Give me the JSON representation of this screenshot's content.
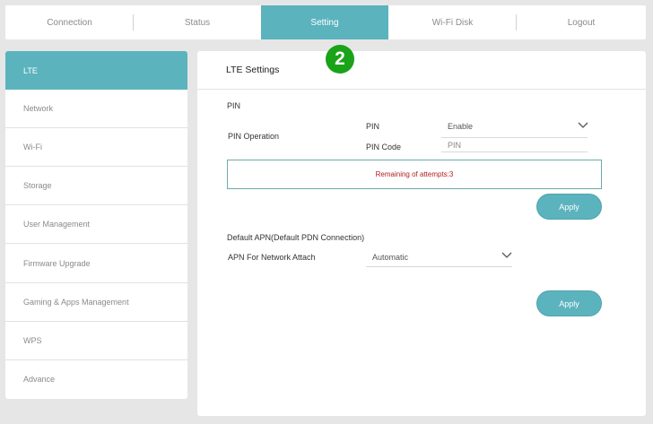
{
  "topnav": {
    "tabs": [
      {
        "label": "Connection"
      },
      {
        "label": "Status"
      },
      {
        "label": "Setting",
        "active": true
      },
      {
        "label": "Wi-Fi Disk"
      },
      {
        "label": "Logout"
      }
    ]
  },
  "sidebar": {
    "items": [
      {
        "label": "LTE",
        "active": true
      },
      {
        "label": "Network"
      },
      {
        "label": "Wi-Fi"
      },
      {
        "label": "Storage"
      },
      {
        "label": "User Management"
      },
      {
        "label": "Firmware Upgrade"
      },
      {
        "label": "Gaming & Apps Management"
      },
      {
        "label": "WPS"
      },
      {
        "label": "Advance"
      }
    ]
  },
  "main": {
    "title": "LTE Settings",
    "step_badge": "2",
    "pin_section": {
      "heading": "PIN",
      "operation_label": "PIN Operation",
      "pin_label": "PIN",
      "pin_value": "Enable",
      "pin_code_label": "PIN Code",
      "pin_code_placeholder": "PIN",
      "attempts_text": "Remaining of attempts:3",
      "apply_label": "Apply"
    },
    "apn_section": {
      "heading": "Default APN(Default PDN Connection)",
      "attach_label": "APN For Network Attach",
      "attach_value": "Automatic",
      "apply_label": "Apply"
    }
  },
  "colors": {
    "accent": "#5bb3be",
    "badge": "#1aa319",
    "warning_text": "#b02020",
    "background": "#e6e6e6"
  }
}
